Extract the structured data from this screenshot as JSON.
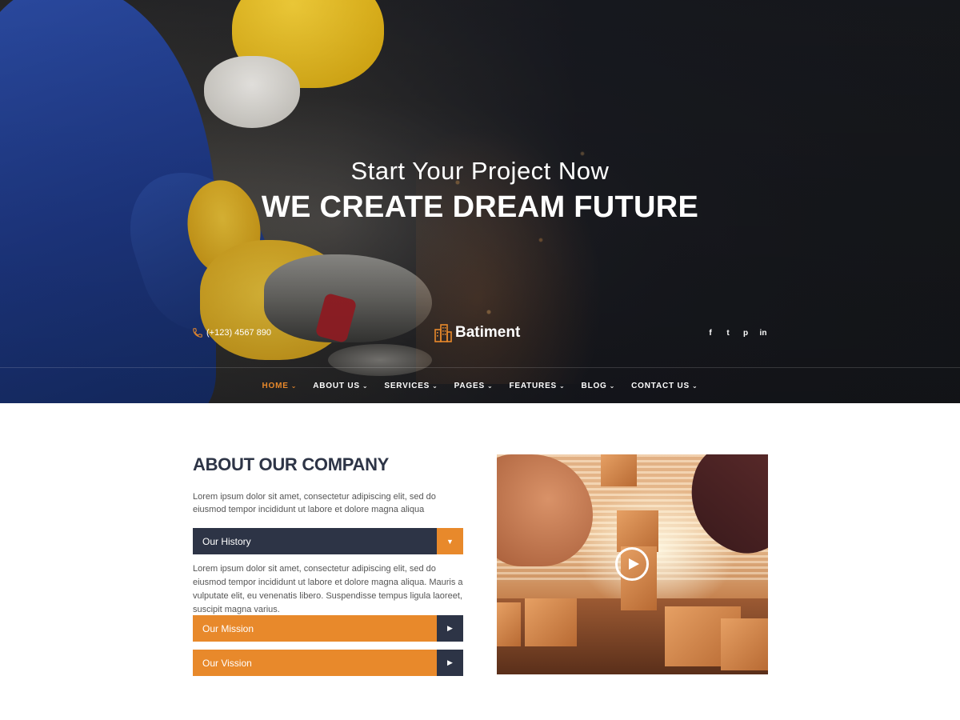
{
  "hero": {
    "subtitle": "Start Your Project Now",
    "title": "WE CREATE DREAM FUTURE"
  },
  "topbar": {
    "phone": "(+123) 4567 890",
    "logo_text": "Batiment",
    "social": [
      "f",
      "t",
      "p",
      "in"
    ]
  },
  "nav": {
    "items": [
      {
        "label": "HOME"
      },
      {
        "label": "ABOUT US"
      },
      {
        "label": "SERVICES"
      },
      {
        "label": "PAGES"
      },
      {
        "label": "FEATURES"
      },
      {
        "label": "BLOG"
      },
      {
        "label": "CONTACT US"
      }
    ],
    "caret": "⌄"
  },
  "about": {
    "title": "ABOUT OUR COMPANY",
    "intro": "Lorem ipsum dolor sit amet, consectetur adipiscing elit, sed do eiusmod tempor incididunt ut labore et dolore magna aliqua",
    "accordion": [
      {
        "label": "Our History",
        "open": true,
        "content": "Lorem ipsum dolor sit amet, consectetur adipiscing elit, sed do eiusmod tempor incididunt ut labore et dolore magna aliqua. Mauris a vulputate elit, eu venenatis libero. Suspendisse tempus ligula laoreet, suscipit magna varius."
      },
      {
        "label": "Our Mission",
        "open": false
      },
      {
        "label": "Our Vission",
        "open": false
      }
    ]
  },
  "icons": {
    "caret_down": "▼",
    "caret_right": "▶"
  },
  "colors": {
    "accent": "#e8892b",
    "dark": "#2d3446"
  }
}
